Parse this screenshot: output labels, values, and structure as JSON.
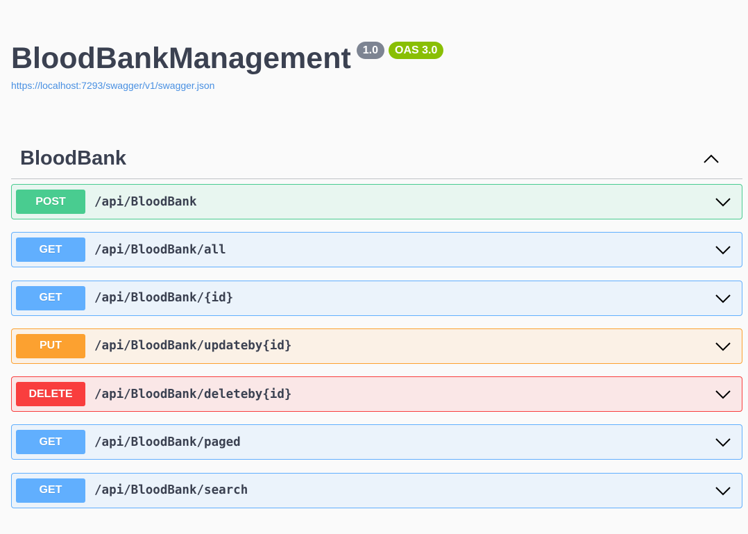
{
  "info": {
    "title": "BloodBankManagement",
    "version": "1.0",
    "oas": "OAS 3.0",
    "spec_url": "https://localhost:7293/swagger/v1/swagger.json"
  },
  "colors": {
    "version_badge": "#7d8492",
    "oas_badge": "#89bf04",
    "post": "#49cc90",
    "get": "#61affe",
    "put": "#fca130",
    "delete": "#f93e3e"
  },
  "tag": {
    "name": "BloodBank",
    "toggle_icon": "chevron-up-icon"
  },
  "operations": [
    {
      "method": "POST",
      "path": "/api/BloodBank",
      "icon": "chevron-down-icon"
    },
    {
      "method": "GET",
      "path": "/api/BloodBank/all",
      "icon": "chevron-down-icon"
    },
    {
      "method": "GET",
      "path": "/api/BloodBank/{id}",
      "icon": "chevron-down-icon"
    },
    {
      "method": "PUT",
      "path": "/api/BloodBank/updateby{id}",
      "icon": "chevron-down-icon"
    },
    {
      "method": "DELETE",
      "path": "/api/BloodBank/deleteby{id}",
      "icon": "chevron-down-icon"
    },
    {
      "method": "GET",
      "path": "/api/BloodBank/paged",
      "icon": "chevron-down-icon"
    },
    {
      "method": "GET",
      "path": "/api/BloodBank/search",
      "icon": "chevron-down-icon"
    }
  ]
}
